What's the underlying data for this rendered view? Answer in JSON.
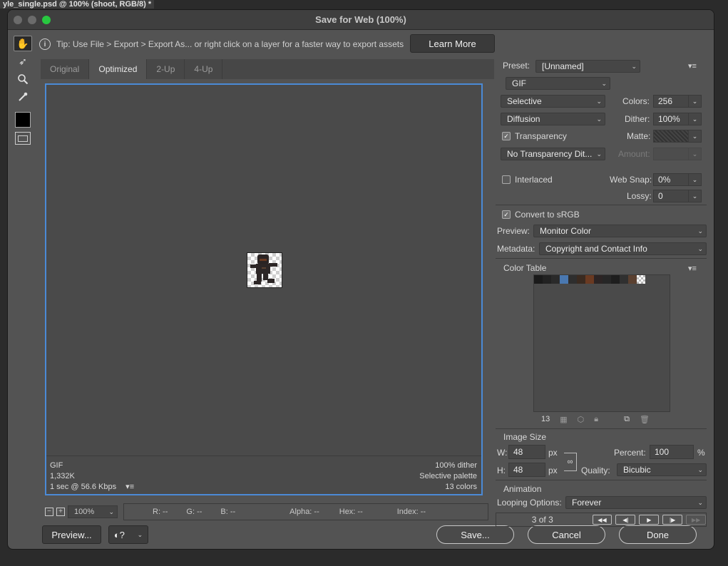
{
  "doc_tab": "yle_single.psd @ 100% (shoot, RGB/8) *",
  "dialog_title": "Save for Web (100%)",
  "tip": {
    "text": "Tip: Use File > Export > Export As...  or right click on a layer for a faster way to export assets",
    "learn_more": "Learn More"
  },
  "view_tabs": [
    "Original",
    "Optimized",
    "2-Up",
    "4-Up"
  ],
  "active_tab": "Optimized",
  "canvas_info": {
    "format": "GIF",
    "size": "1,332K",
    "time": "1 sec @ 56.6 Kbps",
    "dither": "100% dither",
    "palette": "Selective palette",
    "colors": "13 colors"
  },
  "status": {
    "zoom": "100%",
    "r": "R: --",
    "g": "G: --",
    "b": "B: --",
    "alpha": "Alpha: --",
    "hex": "Hex: --",
    "index": "Index: --"
  },
  "buttons": {
    "preview": "Preview...",
    "save": "Save...",
    "cancel": "Cancel",
    "done": "Done"
  },
  "settings": {
    "preset_label": "Preset:",
    "preset_value": "[Unnamed]",
    "format": "GIF",
    "reduction": "Selective",
    "colors_label": "Colors:",
    "colors_value": "256",
    "dither_algo": "Diffusion",
    "dither_label": "Dither:",
    "dither_value": "100%",
    "transparency_label": "Transparency",
    "matte_label": "Matte:",
    "transparency_dither": "No Transparency Dit...",
    "amount_label": "Amount:",
    "interlaced_label": "Interlaced",
    "websnap_label": "Web Snap:",
    "websnap_value": "0%",
    "lossy_label": "Lossy:",
    "lossy_value": "0",
    "convert_srgb_label": "Convert to sRGB",
    "preview_label": "Preview:",
    "preview_value": "Monitor Color",
    "metadata_label": "Metadata:",
    "metadata_value": "Copyright and Contact Info"
  },
  "color_table": {
    "label": "Color Table",
    "count": "13",
    "swatches": [
      "#1a1a1a",
      "#222222",
      "#2a2a2a",
      "#4a78b0",
      "#2e2e2e",
      "#3a2a20",
      "#6a3a22",
      "#2c2424",
      "#262626",
      "#1e1e1e",
      "#303030",
      "#5a4030",
      "checker"
    ]
  },
  "image_size": {
    "label": "Image Size",
    "w_label": "W:",
    "w_value": "48",
    "h_label": "H:",
    "h_value": "48",
    "unit": "px",
    "percent_label": "Percent:",
    "percent_value": "100",
    "percent_unit": "%",
    "quality_label": "Quality:",
    "quality_value": "Bicubic"
  },
  "animation": {
    "label": "Animation",
    "looping_label": "Looping Options:",
    "looping_value": "Forever",
    "frame": "3 of 3"
  }
}
